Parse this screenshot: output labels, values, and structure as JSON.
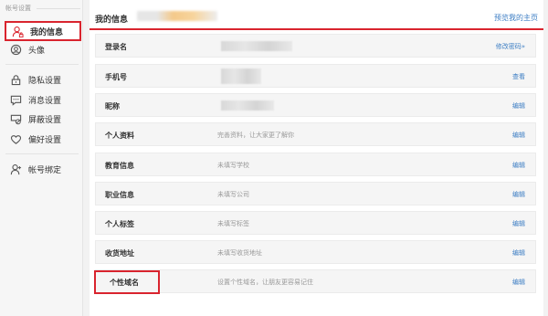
{
  "sidebar": {
    "header": "帐号设置",
    "items": [
      {
        "label": "我的信息",
        "icon": "user-lock-icon"
      },
      {
        "label": "头像",
        "icon": "avatar-icon"
      },
      {
        "label": "隐私设置",
        "icon": "lock-icon"
      },
      {
        "label": "消息设置",
        "icon": "message-icon"
      },
      {
        "label": "屏蔽设置",
        "icon": "block-icon"
      },
      {
        "label": "偏好设置",
        "icon": "heart-icon"
      },
      {
        "label": "帐号绑定",
        "icon": "user-bind-icon"
      }
    ]
  },
  "main": {
    "title": "我的信息",
    "preview_link": "预览我的主页",
    "rows": [
      {
        "label": "登录名",
        "value": "",
        "action": "修改密码»"
      },
      {
        "label": "手机号",
        "value": "",
        "action": "查看"
      },
      {
        "label": "昵称",
        "value": "",
        "action": "编辑"
      },
      {
        "label": "个人资料",
        "value": "完善资料，让大家更了解你",
        "action": "编辑"
      },
      {
        "label": "教育信息",
        "value": "未填写学校",
        "action": "编辑"
      },
      {
        "label": "职业信息",
        "value": "未填写公司",
        "action": "编辑"
      },
      {
        "label": "个人标签",
        "value": "未填写标签",
        "action": "编辑"
      },
      {
        "label": "收货地址",
        "value": "未填写收货地址",
        "action": "编辑"
      },
      {
        "label": "个性域名",
        "value": "设置个性域名，让朋友更容易记住",
        "action": "编辑"
      }
    ]
  },
  "colors": {
    "accent": "#d9242e",
    "link": "#3d7ec4"
  }
}
